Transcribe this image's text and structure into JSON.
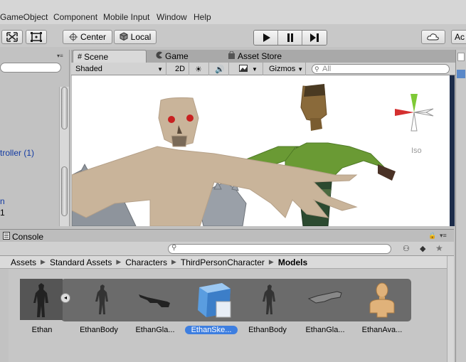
{
  "menu": {
    "items": [
      "GameObject",
      "Component",
      "Mobile Input",
      "Window",
      "Help"
    ]
  },
  "toolbar": {
    "center_label": "Center",
    "local_label": "Local",
    "account_label": "Ac"
  },
  "hierarchy": {
    "items": [
      {
        "text": "troller (1)",
        "color": "blue"
      },
      {
        "text": "n",
        "color": "blue"
      },
      {
        "text": "1",
        "color": "black"
      }
    ]
  },
  "scene_tabs": {
    "scene": "Scene",
    "game": "Game",
    "asset_store": "Asset Store"
  },
  "scene_toolbar": {
    "shading_mode": "Shaded",
    "mode_2d": "2D",
    "gizmos": "Gizmos",
    "search_placeholder": "All"
  },
  "scene_view": {
    "projection": "Iso"
  },
  "console": {
    "tab_label": "Console"
  },
  "project": {
    "breadcrumb": [
      "Assets",
      "Standard Assets",
      "Characters",
      "ThirdPersonCharacter",
      "Models"
    ],
    "assets": [
      {
        "label": "Ethan",
        "type": "model-prefab"
      },
      {
        "label": "EthanBody",
        "type": "mesh"
      },
      {
        "label": "EthanGla...",
        "type": "glasses-mesh"
      },
      {
        "label": "EthanSke...",
        "type": "cube-mesh",
        "selected": true
      },
      {
        "label": "EthanBody",
        "type": "mesh"
      },
      {
        "label": "EthanGla...",
        "type": "glasses-mesh"
      },
      {
        "label": "EthanAva...",
        "type": "avatar"
      }
    ]
  },
  "colors": {
    "selection": "#3d7ee0",
    "scene_bg": "#ffffff",
    "link_blue": "#123aa2"
  }
}
